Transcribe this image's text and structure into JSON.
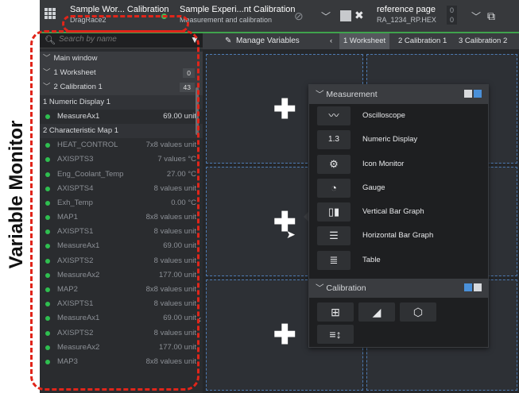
{
  "annotation": {
    "label": "Variable Monitor",
    "color": "#e0251a"
  },
  "topbar": {
    "project_title": "Sample Wor... Calibration",
    "project_sub": "DragRace2",
    "experiment_title": "Sample Experi...nt Calibration",
    "experiment_sub": "Measurement and calibration",
    "reference_title": "reference page",
    "reference_sub": "RA_1234_RP.HEX",
    "ref_num1": "0",
    "ref_num2": "0",
    "accent_color": "#3fa34d"
  },
  "sidebar": {
    "search_placeholder": "Search by name",
    "headers": [
      {
        "label": "Main window"
      },
      {
        "label": "1 Worksheet",
        "count": "0"
      },
      {
        "label": "2 Calibration 1",
        "count": "43"
      }
    ],
    "groups": [
      "1 Numeric Display 1",
      "2 Characteristic Map 1"
    ],
    "items": [
      {
        "name": "MeasureAx1",
        "value": "69.00 unit"
      },
      {
        "name": "HEAT_CONTROL",
        "value": "7x8 values unit"
      },
      {
        "name": "AXISPTS3",
        "value": "7 values °C"
      },
      {
        "name": "Eng_Coolant_Temp",
        "value": "27.00 °C"
      },
      {
        "name": "AXISPTS4",
        "value": "8 values unit"
      },
      {
        "name": "Exh_Temp",
        "value": "0.00 °C"
      },
      {
        "name": "MAP1",
        "value": "8x8 values unit"
      },
      {
        "name": "AXISPTS1",
        "value": "8 values unit"
      },
      {
        "name": "MeasureAx1",
        "value": "69.00 unit"
      },
      {
        "name": "AXISPTS2",
        "value": "8 values unit"
      },
      {
        "name": "MeasureAx2",
        "value": "177.00 unit"
      },
      {
        "name": "MAP2",
        "value": "8x8 values unit"
      },
      {
        "name": "AXISPTS1",
        "value": "8 values unit"
      },
      {
        "name": "MeasureAx1",
        "value": "69.00 unit"
      },
      {
        "name": "AXISPTS2",
        "value": "8 values unit"
      },
      {
        "name": "MeasureAx2",
        "value": "177.00 unit"
      },
      {
        "name": "MAP3",
        "value": "8x8 values unit"
      }
    ]
  },
  "tabs": {
    "manage": "Manage Variables",
    "items": [
      "1 Worksheet",
      "2 Calibration 1",
      "3 Calibration 2"
    ]
  },
  "popup": {
    "measurement_title": "Measurement",
    "measurement_items": [
      {
        "icon": "oscilloscope-icon",
        "label": "Oscilloscope",
        "glyph": "〰"
      },
      {
        "icon": "numeric-display-icon",
        "label": "Numeric Display",
        "glyph": "1.3"
      },
      {
        "icon": "icon-monitor-icon",
        "label": "Icon Monitor",
        "glyph": "⚙"
      },
      {
        "icon": "gauge-icon",
        "label": "Gauge",
        "glyph": "◔"
      },
      {
        "icon": "vertical-bar-graph-icon",
        "label": "Vertical Bar Graph",
        "glyph": "▯▮"
      },
      {
        "icon": "horizontal-bar-graph-icon",
        "label": "Horizontal Bar Graph",
        "glyph": "☰"
      },
      {
        "icon": "table-icon",
        "label": "Table",
        "glyph": "≣"
      }
    ],
    "calibration_title": "Calibration"
  }
}
